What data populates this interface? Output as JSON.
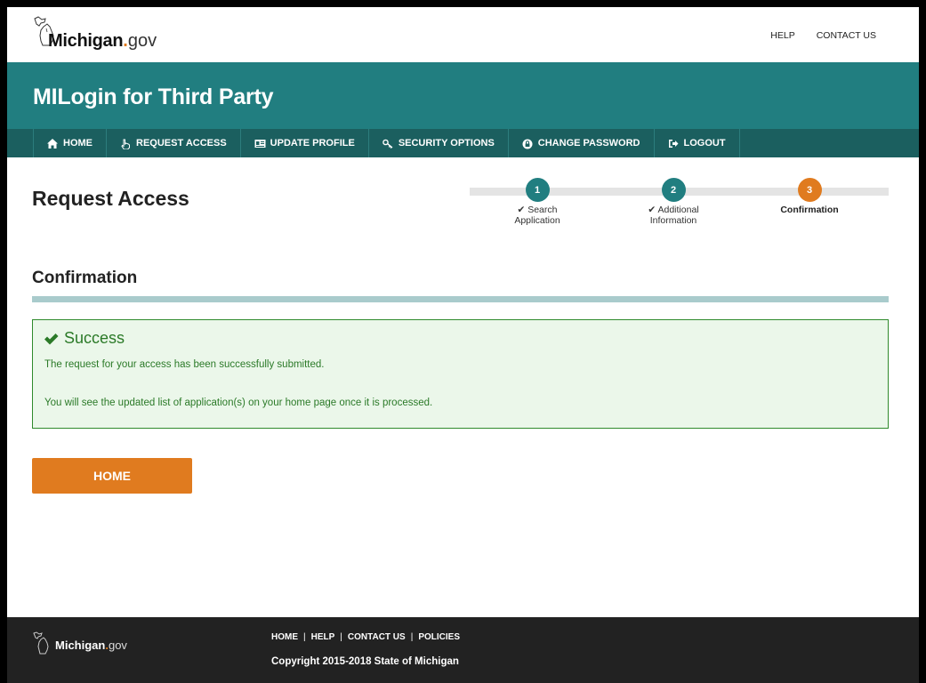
{
  "header": {
    "logo": {
      "brand": "Michigan",
      "dot": ".",
      "suffix": "gov"
    },
    "links": [
      "HELP",
      "CONTACT US"
    ]
  },
  "banner": {
    "title": "MILogin for Third Party"
  },
  "nav": {
    "items": [
      {
        "label": "HOME",
        "icon": "home-icon"
      },
      {
        "label": "REQUEST ACCESS",
        "icon": "hand-pointer-icon"
      },
      {
        "label": "UPDATE PROFILE",
        "icon": "id-card-icon"
      },
      {
        "label": "SECURITY OPTIONS",
        "icon": "key-icon"
      },
      {
        "label": "CHANGE PASSWORD",
        "icon": "lock-icon"
      },
      {
        "label": "LOGOUT",
        "icon": "sign-out-icon"
      }
    ]
  },
  "page": {
    "title": "Request Access"
  },
  "stepper": {
    "steps": [
      {
        "number": "1",
        "label_line1": "✔ Search",
        "label_line2": "Application",
        "status": "done"
      },
      {
        "number": "2",
        "label_line1": "✔ Additional",
        "label_line2": "Information",
        "status": "done"
      },
      {
        "number": "3",
        "label_line1": "Confirmation",
        "label_line2": "",
        "status": "active"
      }
    ]
  },
  "section": {
    "title": "Confirmation"
  },
  "alert": {
    "heading": "Success",
    "message1": "The request for your access has been successfully submitted.",
    "message2": "You will see the updated list of application(s) on your home page once it is processed."
  },
  "actions": {
    "home_label": "HOME"
  },
  "footer": {
    "logo": {
      "brand": "Michigan",
      "dot": ".",
      "suffix": "gov"
    },
    "links": [
      "HOME",
      "HELP",
      "CONTACT US",
      "POLICIES"
    ],
    "separator": "|",
    "copyright": "Copyright 2015-2018 State of Michigan"
  },
  "colors": {
    "teal": "#217e80",
    "nav_dark_teal": "#1b5f5f",
    "orange": "#e07b1f",
    "success_green": "#2b7a28",
    "success_bg": "#ebf7ea",
    "footer_bg": "#222222"
  }
}
